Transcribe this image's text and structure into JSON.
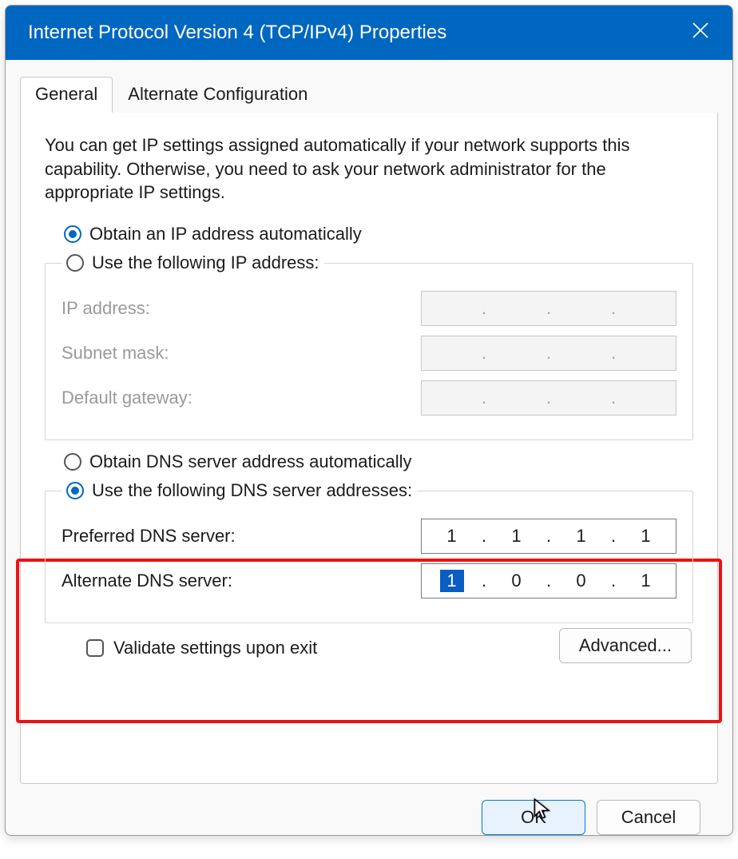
{
  "window": {
    "title": "Internet Protocol Version 4 (TCP/IPv4) Properties"
  },
  "tabs": {
    "general": "General",
    "alternate": "Alternate Configuration"
  },
  "description": "You can get IP settings assigned automatically if your network supports this capability. Otherwise, you need to ask your network administrator for the appropriate IP settings.",
  "radios": {
    "obtain_ip": "Obtain an IP address automatically",
    "use_ip": "Use the following IP address:",
    "obtain_dns": "Obtain DNS server address automatically",
    "use_dns": "Use the following DNS server addresses:"
  },
  "ip_group": {
    "ip_address_label": "IP address:",
    "subnet_label": "Subnet mask:",
    "gateway_label": "Default gateway:",
    "ip_address": [
      "",
      "",
      "",
      ""
    ],
    "subnet": [
      "",
      "",
      "",
      ""
    ],
    "gateway": [
      "",
      "",
      "",
      ""
    ]
  },
  "dns_group": {
    "preferred_label": "Preferred DNS server:",
    "alternate_label": "Alternate DNS server:",
    "preferred": [
      "1",
      "1",
      "1",
      "1"
    ],
    "alternate": [
      "1",
      "0",
      "0",
      "1"
    ]
  },
  "validate_label": "Validate settings upon exit",
  "buttons": {
    "advanced": "Advanced...",
    "ok": "OK",
    "cancel": "Cancel"
  }
}
